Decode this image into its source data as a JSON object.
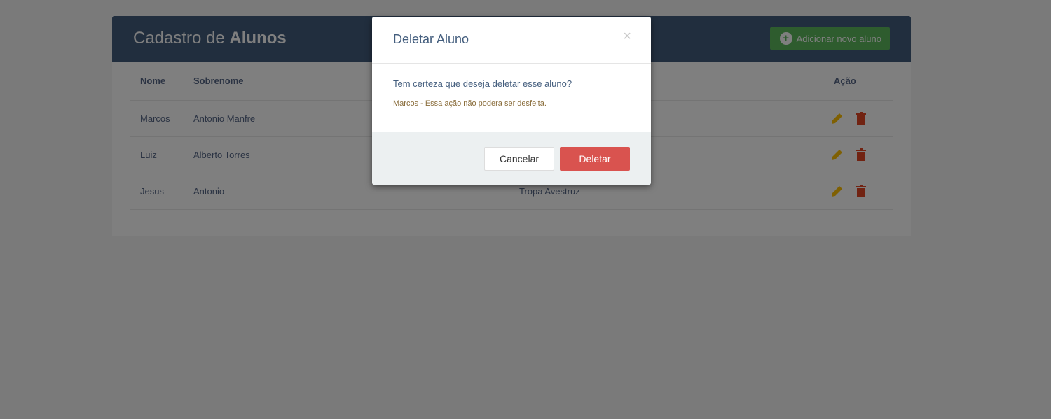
{
  "header": {
    "title_prefix": "Cadastro de ",
    "title_bold": "Alunos",
    "add_button_label": "Adicionar novo aluno"
  },
  "table": {
    "columns": [
      "Nome",
      "Sobrenome",
      "",
      "Ação"
    ],
    "rows": [
      {
        "nome": "Marcos",
        "sobrenome": "Antonio Manfre",
        "extra": ""
      },
      {
        "nome": "Luiz",
        "sobrenome": "Alberto Torres",
        "extra": ""
      },
      {
        "nome": "Jesus",
        "sobrenome": "Antonio",
        "extra": "Tropa Avestruz"
      }
    ]
  },
  "modal": {
    "title": "Deletar Aluno",
    "close_symbol": "×",
    "question": "Tem certeza que deseja deletar esse aluno?",
    "warning": "Marcos - Essa ação não podera ser desfeita.",
    "cancel_label": "Cancelar",
    "delete_label": "Deletar"
  },
  "colors": {
    "header_bg": "#435d7d",
    "add_button": "#5cb85c",
    "edit_icon": "#ffc107",
    "delete_icon": "#e34724",
    "delete_button": "#d9534f"
  }
}
